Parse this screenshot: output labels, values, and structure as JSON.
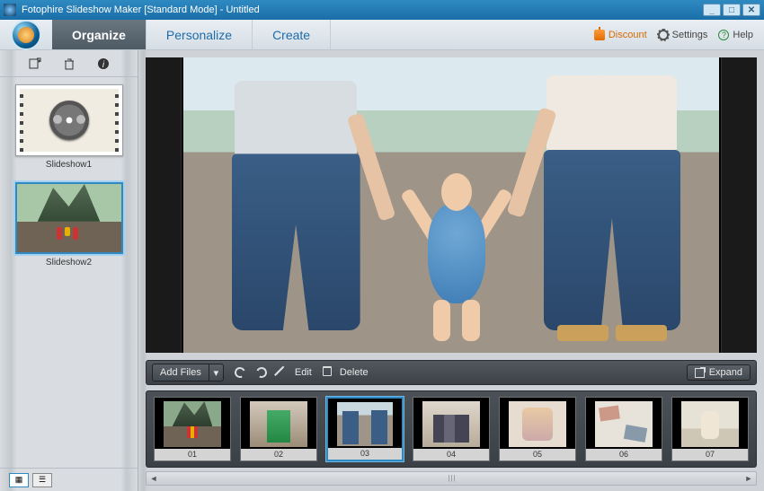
{
  "window": {
    "title": "Fotophire Slideshow Maker [Standard Mode] - Untitled"
  },
  "tabs": {
    "organize": "Organize",
    "personalize": "Personalize",
    "create": "Create"
  },
  "header_tools": {
    "discount": "Discount",
    "settings": "Settings",
    "help": "Help"
  },
  "sidebar": {
    "slideshows": [
      {
        "label": "Slideshow1"
      },
      {
        "label": "Slideshow2"
      }
    ]
  },
  "actionbar": {
    "add_files": "Add Files",
    "edit": "Edit",
    "delete": "Delete",
    "expand": "Expand"
  },
  "thumbs": [
    {
      "num": "01"
    },
    {
      "num": "02"
    },
    {
      "num": "03"
    },
    {
      "num": "04"
    },
    {
      "num": "05"
    },
    {
      "num": "06"
    },
    {
      "num": "07"
    }
  ]
}
